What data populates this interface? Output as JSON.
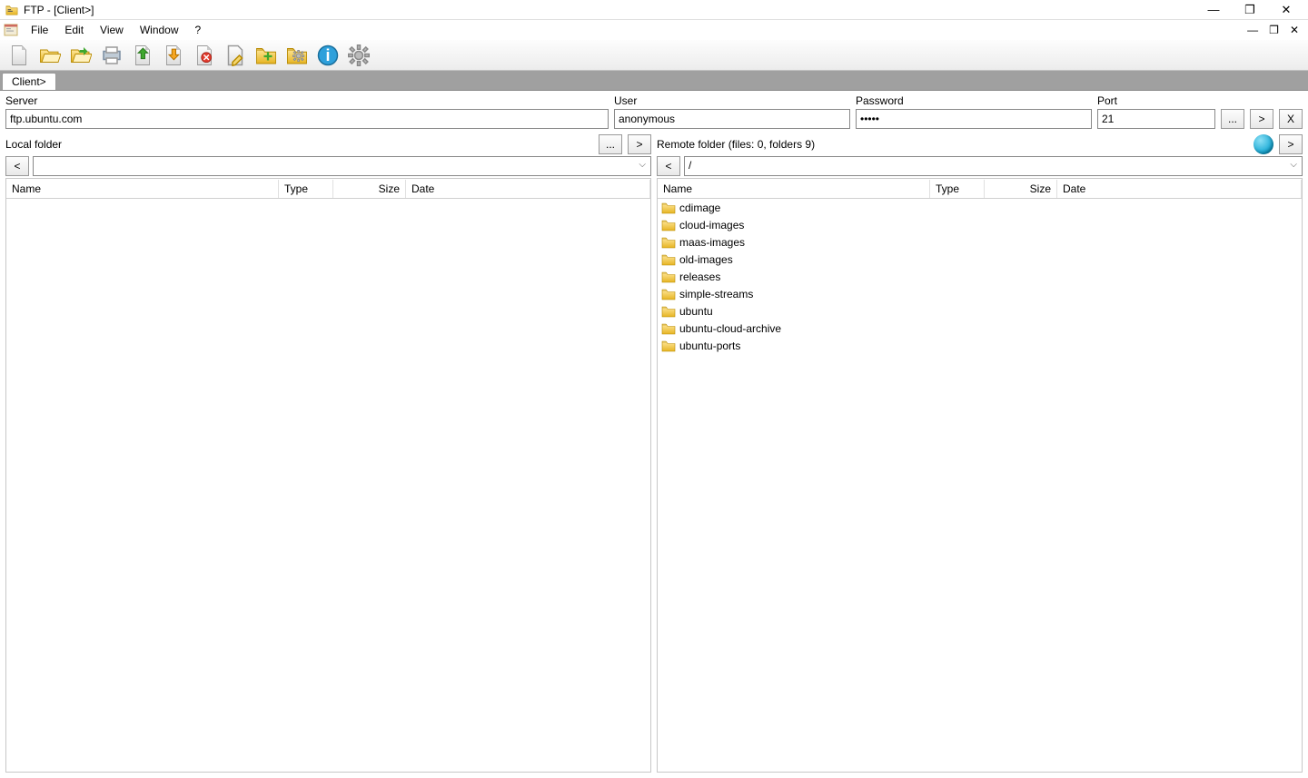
{
  "window": {
    "title": "FTP - [Client>]",
    "min": "—",
    "max": "❐",
    "close": "✕"
  },
  "child_window": {
    "min": "—",
    "max": "❐",
    "close": "✕"
  },
  "menu": {
    "file": "File",
    "edit": "Edit",
    "view": "View",
    "window": "Window",
    "help": "?"
  },
  "tab": {
    "label": "Client>"
  },
  "conn": {
    "server_label": "Server",
    "server": "ftp.ubuntu.com",
    "user_label": "User",
    "user": "anonymous",
    "pass_label": "Password",
    "pass": "•••••",
    "port_label": "Port",
    "port": "21",
    "browse": "...",
    "go": ">",
    "cancel": "X"
  },
  "local": {
    "label": "Local folder",
    "browse": "...",
    "go": ">",
    "back": "<",
    "path": ""
  },
  "remote": {
    "label": "Remote folder (files: 0, folders 9)",
    "go": ">",
    "back": "<",
    "path": "/"
  },
  "columns": {
    "name": "Name",
    "type": "Type",
    "size": "Size",
    "date": "Date"
  },
  "remote_items": [
    {
      "name": "cdimage",
      "type": "",
      "size": "",
      "date": ""
    },
    {
      "name": "cloud-images",
      "type": "",
      "size": "",
      "date": ""
    },
    {
      "name": "maas-images",
      "type": "",
      "size": "",
      "date": ""
    },
    {
      "name": "old-images",
      "type": "",
      "size": "",
      "date": ""
    },
    {
      "name": "releases",
      "type": "",
      "size": "",
      "date": ""
    },
    {
      "name": "simple-streams",
      "type": "",
      "size": "",
      "date": ""
    },
    {
      "name": "ubuntu",
      "type": "",
      "size": "",
      "date": ""
    },
    {
      "name": "ubuntu-cloud-archive",
      "type": "",
      "size": "",
      "date": ""
    },
    {
      "name": "ubuntu-ports",
      "type": "",
      "size": "",
      "date": ""
    }
  ],
  "local_items": []
}
